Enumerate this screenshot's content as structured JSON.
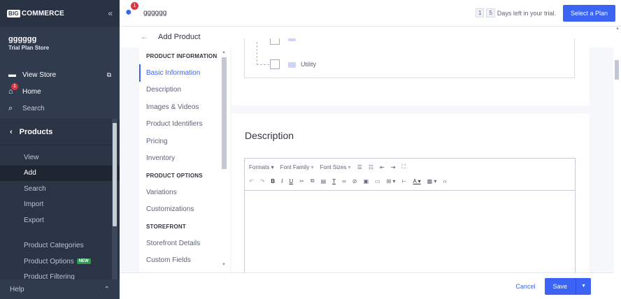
{
  "brand": {
    "logo_prefix": "BIG",
    "logo_text": "COMMERCE"
  },
  "store": {
    "name": "gggggg",
    "plan": "Trial Plan Store"
  },
  "sidebar": {
    "links": [
      {
        "label": "View Store",
        "icon": "storefront-icon"
      },
      {
        "label": "Home",
        "icon": "home-icon",
        "badge": "1"
      },
      {
        "label": "Search",
        "icon": "search-icon"
      }
    ],
    "section": "Products",
    "items": [
      "View",
      "Add",
      "Search",
      "Import",
      "Export",
      "Product Categories",
      "Product Options",
      "Product Filtering"
    ],
    "active_item": "Add",
    "new_badge": "NEW",
    "help": "Help"
  },
  "topbar": {
    "notification_count": "1",
    "store_name": "gggggg",
    "trial_digits": [
      "1",
      "5"
    ],
    "trial_text": "Days left in your trial.",
    "plan_button": "Select a Plan"
  },
  "page": {
    "back": "←",
    "title": "Add Product"
  },
  "secnav": {
    "groups": [
      {
        "heading": "PRODUCT INFORMATION",
        "items": [
          "Basic Information",
          "Description",
          "Images & Videos",
          "Product Identifiers",
          "Pricing",
          "Inventory"
        ]
      },
      {
        "heading": "PRODUCT OPTIONS",
        "items": [
          "Variations",
          "Customizations"
        ]
      },
      {
        "heading": "STOREFRONT",
        "items": [
          "Storefront Details",
          "Custom Fields"
        ]
      }
    ],
    "active": "Basic Information"
  },
  "categories": {
    "visible_item": "Utility"
  },
  "description": {
    "title": "Description",
    "toolbar": {
      "formats": "Formats",
      "font_family": "Font Family",
      "font_sizes": "Font Sizes"
    }
  },
  "footer": {
    "cancel": "Cancel",
    "save": "Save"
  },
  "colors": {
    "accent": "#3c64f4",
    "sidebar": "#303b4d",
    "badge": "#db3643"
  }
}
